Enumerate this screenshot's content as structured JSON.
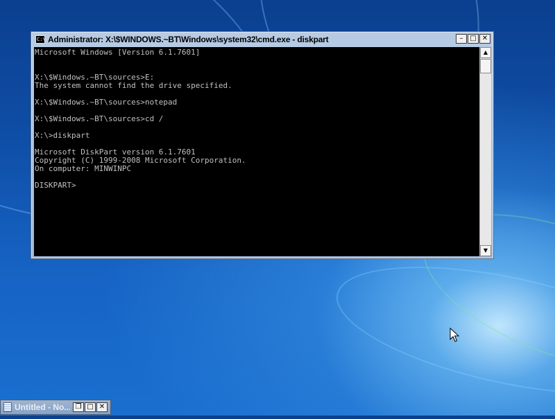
{
  "cmd_window": {
    "title": "Administrator: X:\\$WINDOWS.~BT\\Windows\\system32\\cmd.exe - diskpart",
    "icon": "cmd-icon",
    "icon_text": "C:\\",
    "buttons": {
      "minimize": "–",
      "maximize": "□",
      "close": "✕"
    },
    "console_lines": [
      "Microsoft Windows [Version 6.1.7601]",
      "",
      "",
      "X:\\$Windows.~BT\\sources>E:",
      "The system cannot find the drive specified.",
      "",
      "X:\\$Windows.~BT\\sources>notepad",
      "",
      "X:\\$Windows.~BT\\sources>cd /",
      "",
      "X:\\>diskpart",
      "",
      "Microsoft DiskPart version 6.1.7601",
      "Copyright (C) 1999-2008 Microsoft Corporation.",
      "On computer: MINWINPC",
      "",
      "DISKPART> "
    ],
    "scroll_up": "▲",
    "scroll_down": "▼"
  },
  "mini_window": {
    "title": "Untitled - No...",
    "icon": "notepad-icon",
    "buttons": {
      "restore": "❐",
      "maximize": "□",
      "close": "✕"
    }
  },
  "colors": {
    "console_bg": "#000000",
    "console_fg": "#c0c0c0",
    "desktop_blue": "#1663c4"
  }
}
